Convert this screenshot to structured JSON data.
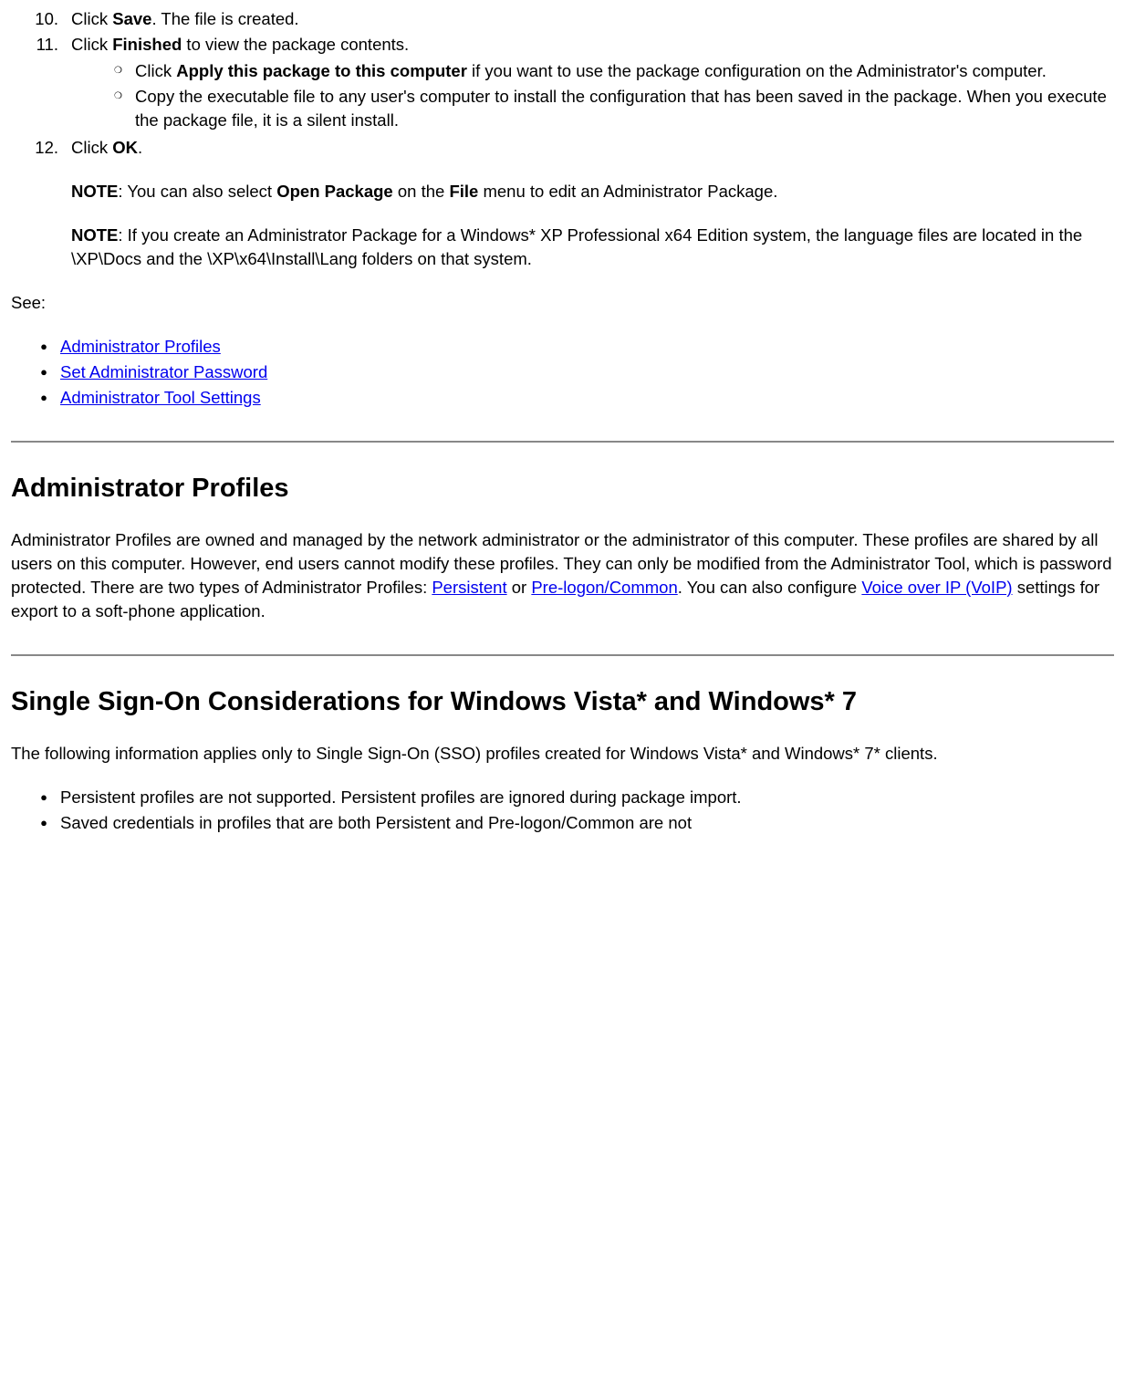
{
  "list": {
    "item10": {
      "num": "10.",
      "prefix": "Click ",
      "bold": "Save",
      "suffix": ". The file is created."
    },
    "item11": {
      "num": "11.",
      "prefix": "Click ",
      "bold": "Finished",
      "suffix": " to view the package contents."
    },
    "item11sub1": {
      "prefix": "Click ",
      "bold": "Apply this package to this computer",
      "suffix": " if you want to use the package configuration on the Administrator's computer."
    },
    "item11sub2": {
      "text": "Copy the executable file to any user's computer to install the configuration that has been saved in the package. When you execute the package file, it is a silent install."
    },
    "item12": {
      "num": "12.",
      "prefix": "Click ",
      "bold": "OK",
      "suffix": "."
    },
    "note1": {
      "bold1": "NOTE",
      "mid1": ": You can also select ",
      "bold2": "Open Package",
      "mid2": " on the ",
      "bold3": "File",
      "suffix": " menu to edit an Administrator Package."
    },
    "note2": {
      "bold1": "NOTE",
      "suffix": ": If you create an Administrator Package for a Windows* XP Professional x64 Edition system, the language files are located in the \\XP\\Docs and the \\XP\\x64\\Install\\Lang folders on that system."
    }
  },
  "see": {
    "label": "See:",
    "links": {
      "l1": "Administrator Profiles",
      "l2": "Set Administrator Password",
      "l3": "Administrator Tool Settings"
    }
  },
  "section1": {
    "heading": "Administrator Profiles",
    "p_pre": "Administrator Profiles are owned and managed by the network administrator or the administrator of this computer. These profiles are shared by all users on this computer. However, end users cannot modify these profiles. They can only be modified from the Administrator Tool, which is password protected. There are two types of Administrator Profiles: ",
    "link1": "Persistent",
    "mid1": " or ",
    "link2": "Pre-logon/Common",
    "mid2": ". You can also configure ",
    "link3": "Voice over IP (VoIP)",
    "suffix": " settings for export to a soft-phone application."
  },
  "section2": {
    "heading": "Single Sign-On Considerations for Windows Vista* and Windows* 7",
    "intro": "The following information applies only to Single Sign-On (SSO) profiles created for Windows Vista* and Windows* 7* clients.",
    "b1": "Persistent profiles are not supported. Persistent profiles are ignored during package import.",
    "b2": "Saved credentials in profiles that are both Persistent and Pre-logon/Common are not"
  }
}
